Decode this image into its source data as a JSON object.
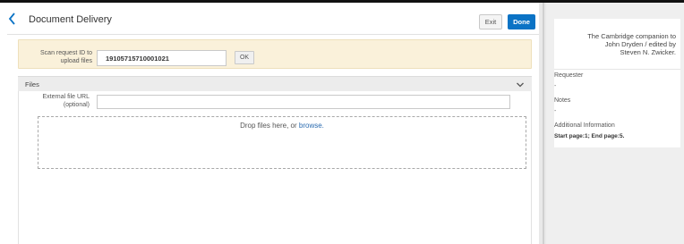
{
  "header": {
    "title": "Document Delivery",
    "exit_label": "Exit",
    "done_label": "Done"
  },
  "scan": {
    "label_line1": "Scan request ID to",
    "label_line2": "upload files",
    "value": "19105715710001021",
    "ok_label": "OK"
  },
  "files": {
    "section_label": "Files",
    "ext_label_line1": "External file URL",
    "ext_label_line2": "(optional)",
    "ext_value": "",
    "drop_text": "Drop files here, or ",
    "browse_label": "browse."
  },
  "side": {
    "title_line1": "The Cambridge companion to",
    "title_line2": "John Dryden / edited by",
    "title_line3": "Steven N. Zwicker.",
    "requester_label": "Requester",
    "requester_value": "-",
    "notes_label": "Notes",
    "notes_value": "-",
    "additional_label": "Additional Information",
    "additional_value": "Start page:1; End page:5."
  },
  "colors": {
    "accent": "#0b73c5",
    "scan_background": "#faf1da",
    "link": "#2a6bb0"
  },
  "icons": {
    "back": "chevron-left-icon",
    "files_toggle": "chevron-down-icon"
  }
}
